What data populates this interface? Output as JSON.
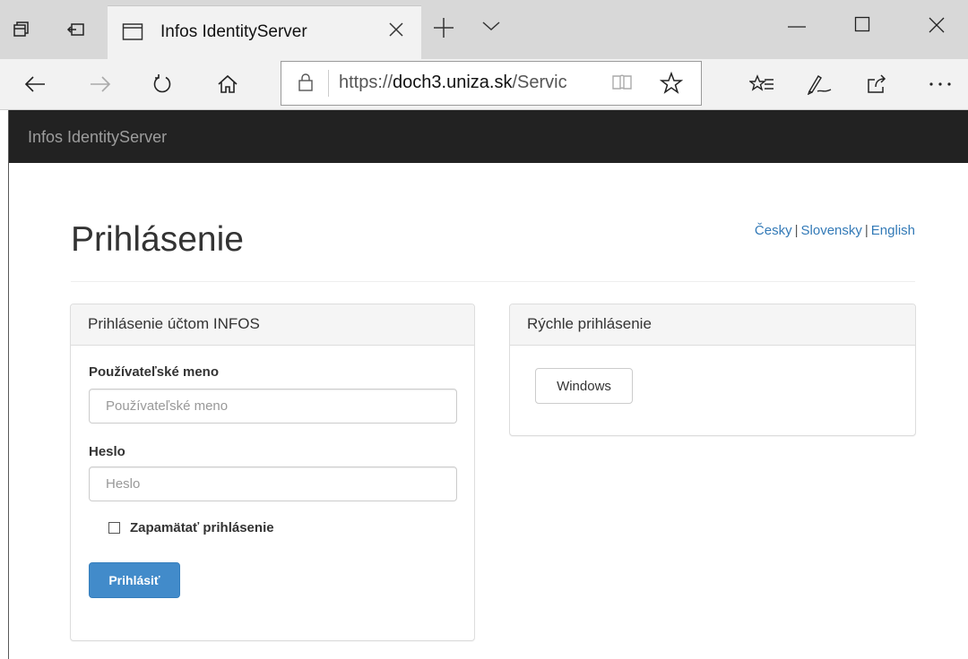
{
  "browser": {
    "tab_title": "Infos IdentityServer",
    "url_scheme": "https://",
    "url_host": "doch3.uniza.sk",
    "url_path": "/Servic"
  },
  "site": {
    "brand": "Infos IdentityServer"
  },
  "page": {
    "title": "Prihlásenie",
    "languages": [
      "Česky",
      "Slovensky",
      "English"
    ]
  },
  "login_panel": {
    "heading": "Prihlásenie účtom INFOS",
    "username_label": "Používateľské meno",
    "username_placeholder": "Používateľské meno",
    "username_value": "",
    "password_label": "Heslo",
    "password_placeholder": "Heslo",
    "password_value": "",
    "remember_label": "Zapamätať prihlásenie",
    "remember_checked": false,
    "submit_label": "Prihlásiť"
  },
  "quick_panel": {
    "heading": "Rýchle prihlásenie",
    "windows_label": "Windows"
  },
  "colors": {
    "navbar_bg": "#222222",
    "link": "#337ab7",
    "primary_button": "#428bca"
  },
  "icons": {
    "tabs_aside": "tabs-aside-icon",
    "set_aside": "set-tabs-aside-icon",
    "tab_page": "tab-page-icon",
    "close": "close-icon",
    "new_tab": "plus-icon",
    "tab_list": "chevron-down-icon",
    "back": "arrow-left-icon",
    "forward": "arrow-right-icon",
    "refresh": "refresh-icon",
    "home": "home-icon",
    "lock": "lock-icon",
    "reading_view": "book-icon",
    "favorite": "star-icon",
    "favorites_hub": "favorites-hub-icon",
    "web_note": "pen-icon",
    "share": "share-icon",
    "more": "more-icon"
  }
}
